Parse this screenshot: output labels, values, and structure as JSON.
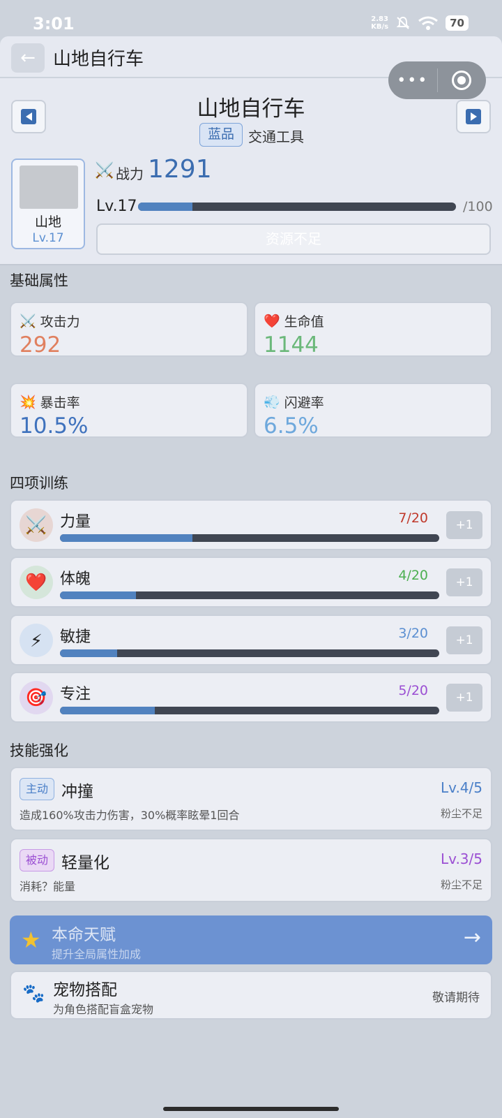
{
  "status_bar": {
    "time": "3:01",
    "net_speed_value": "2.83",
    "net_speed_unit": "KB/s",
    "battery": "70"
  },
  "navbar": {
    "back_icon": "←",
    "title": "山地自行车"
  },
  "capsule": {
    "more_icon": "•••"
  },
  "header": {
    "item_name": "山地自行车",
    "rarity": "蓝品",
    "category": "交通工具",
    "thumb_name": "山地",
    "thumb_level": "Lv.17",
    "power_icon": "⚔️",
    "power_label": "战力",
    "power_value": "1291",
    "level_label": "Lv.17",
    "level_progress": 0.17,
    "level_max": "/100",
    "upgrade_button": "资源不足"
  },
  "basic_attributes": {
    "title": "基础属性",
    "items": [
      {
        "icon": "⚔️",
        "label": "攻击力",
        "value": "292",
        "color": "#e0805f"
      },
      {
        "icon": "❤️",
        "label": "生命值",
        "value": "1144",
        "color": "#6bb87a"
      },
      {
        "icon": "💥",
        "label": "暴击率",
        "value": "10.5%",
        "color": "#3f72bd"
      },
      {
        "icon": "💨",
        "label": "闪避率",
        "value": "6.5%",
        "color": "#6ea8dc"
      }
    ]
  },
  "training": {
    "title": "四项训练",
    "items": [
      {
        "icon": "⚔️",
        "name": "力量",
        "count": "7/20",
        "progress": 0.35,
        "color": "#c0392b",
        "icon_bg": "#e7d6d3",
        "plus": "+1"
      },
      {
        "icon": "❤️",
        "name": "体魄",
        "count": "4/20",
        "progress": 0.2,
        "color": "#4caf50",
        "icon_bg": "#d5e6da",
        "plus": "+1"
      },
      {
        "icon": "⚡",
        "name": "敏捷",
        "count": "3/20",
        "progress": 0.15,
        "color": "#5b8fd1",
        "icon_bg": "#d6e2f2",
        "plus": "+1"
      },
      {
        "icon": "🎯",
        "name": "专注",
        "count": "5/20",
        "progress": 0.25,
        "color": "#9b4fd3",
        "icon_bg": "#e1d8f0",
        "plus": "+1"
      }
    ]
  },
  "skills": {
    "title": "技能强化",
    "items": [
      {
        "tag": "主动",
        "name": "冲撞",
        "level": "Lv.4/5",
        "desc": "造成160%攻击力伤害，30%概率眩晕1回合",
        "status": "粉尘不足",
        "color": "#4a7fc8",
        "tag_bg": "#dce6f5"
      },
      {
        "tag": "被动",
        "name": "轻量化",
        "level": "Lv.3/5",
        "desc": "消耗？能量",
        "status": "粉尘不足",
        "color": "#9b4fd3",
        "tag_bg": "#ead9f5"
      }
    ]
  },
  "talent": {
    "icon": "★",
    "title": "本命天赋",
    "subtitle": "提升全局属性加成",
    "arrow": "→"
  },
  "pet": {
    "icon": "🐾",
    "title": "宠物搭配",
    "subtitle": "为角色搭配盲盒宠物",
    "status": "敬请期待"
  }
}
